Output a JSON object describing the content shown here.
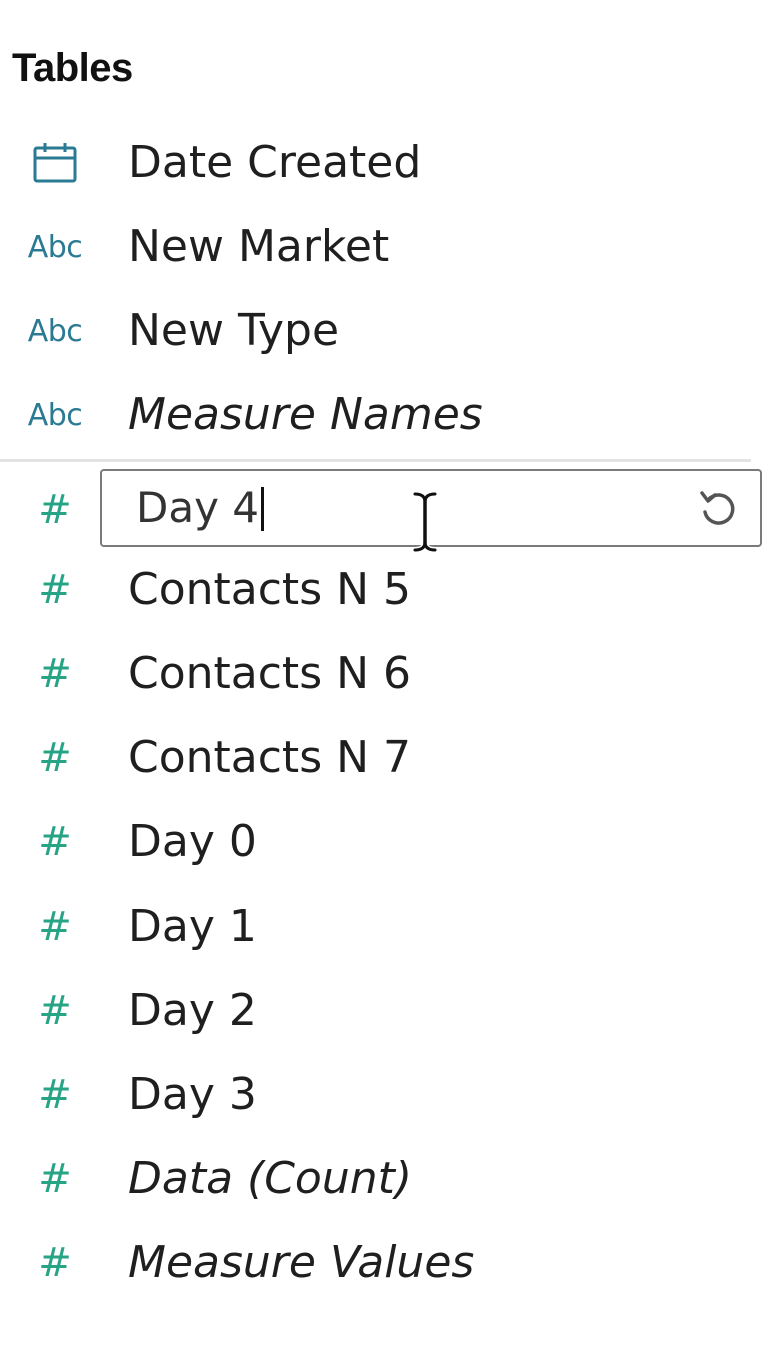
{
  "panel": {
    "section_title": "Tables"
  },
  "dimensions": [
    {
      "label": "Date Created",
      "icon": "calendar-icon",
      "type_glyph": "",
      "italic": false
    },
    {
      "label": "New Market",
      "icon": "string-type-icon",
      "type_glyph": "Abc",
      "italic": false
    },
    {
      "label": "New Type",
      "icon": "string-type-icon",
      "type_glyph": "Abc",
      "italic": false
    },
    {
      "label": "Measure Names",
      "icon": "string-type-icon",
      "type_glyph": "Abc",
      "italic": true
    }
  ],
  "rename": {
    "icon": "number-type-icon",
    "type_glyph": "#",
    "value": "Day 4",
    "reset_icon": "reset-icon"
  },
  "measures": [
    {
      "label": "Contacts N 5",
      "icon": "number-type-icon",
      "type_glyph": "#",
      "italic": false
    },
    {
      "label": "Contacts N 6",
      "icon": "number-type-icon",
      "type_glyph": "#",
      "italic": false
    },
    {
      "label": "Contacts N 7",
      "icon": "number-type-icon",
      "type_glyph": "#",
      "italic": false
    },
    {
      "label": "Day 0",
      "icon": "number-type-icon",
      "type_glyph": "#",
      "italic": false
    },
    {
      "label": "Day 1",
      "icon": "number-type-icon",
      "type_glyph": "#",
      "italic": false
    },
    {
      "label": "Day 2",
      "icon": "number-type-icon",
      "type_glyph": "#",
      "italic": false
    },
    {
      "label": "Day 3",
      "icon": "number-type-icon",
      "type_glyph": "#",
      "italic": false
    },
    {
      "label": "Data (Count)",
      "icon": "number-type-icon",
      "type_glyph": "#",
      "italic": true
    },
    {
      "label": "Measure Values",
      "icon": "number-type-icon",
      "type_glyph": "#",
      "italic": true
    }
  ],
  "colors": {
    "dimension_icon": "#2a7a93",
    "measure_icon": "#27a386",
    "divider": "#e3e3e3",
    "input_border": "#7a7a7a"
  }
}
